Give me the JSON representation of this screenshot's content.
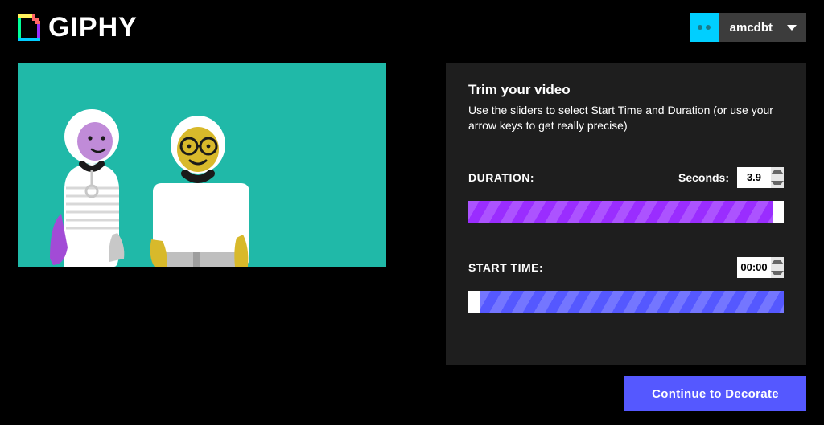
{
  "header": {
    "logo_text": "GIPHY",
    "user_name": "amcdbt"
  },
  "panel": {
    "title": "Trim your video",
    "subtitle": "Use the sliders to select Start Time and Duration (or use your arrow keys to get really precise)",
    "duration": {
      "label": "DURATION:",
      "unit": "Seconds:",
      "value": "3.9"
    },
    "start_time": {
      "label": "START TIME:",
      "value": "00:00"
    }
  },
  "cta": {
    "label": "Continue to Decorate"
  }
}
